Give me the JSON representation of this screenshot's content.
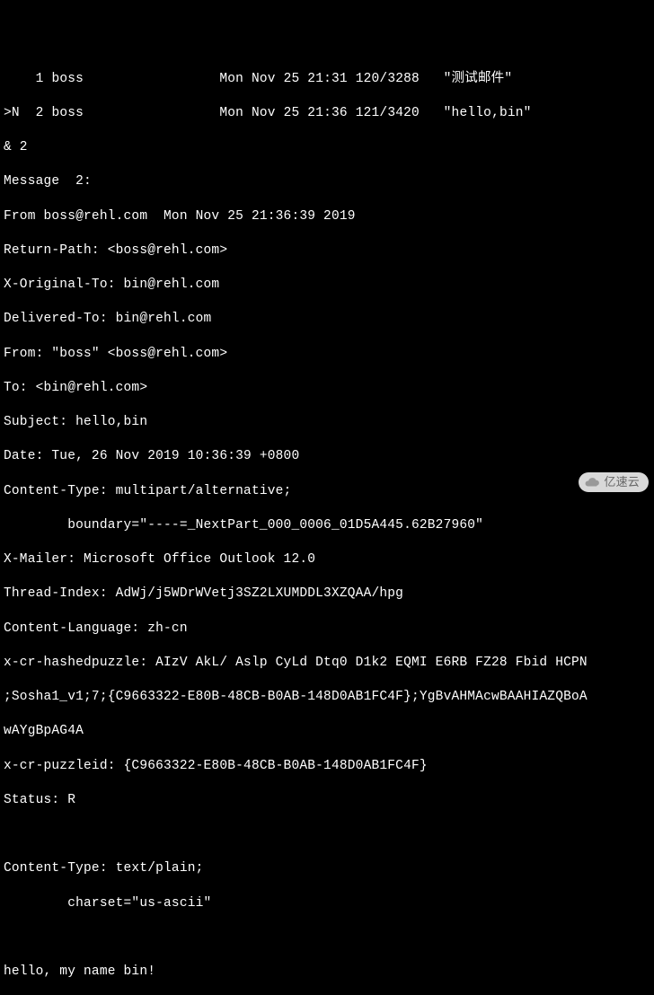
{
  "mail_list": [
    {
      "flag": "   ",
      "num": "1",
      "from": "boss",
      "date": "Mon Nov 25 21:31",
      "size": "120/3288",
      "subject": "\"测试邮件\""
    },
    {
      "flag": ">N ",
      "num": "2",
      "from": "boss",
      "date": "Mon Nov 25 21:36",
      "size": "121/3420",
      "subject": "\"hello,bin\""
    }
  ],
  "prompt": "& 2",
  "msg_header": "Message  2:",
  "headers": [
    "From boss@rehl.com  Mon Nov 25 21:36:39 2019",
    "Return-Path: <boss@rehl.com>",
    "X-Original-To: bin@rehl.com",
    "Delivered-To: bin@rehl.com",
    "From: \"boss\" <boss@rehl.com>",
    "To: <bin@rehl.com>",
    "Subject: hello,bin",
    "Date: Tue, 26 Nov 2019 10:36:39 +0800",
    "Content-Type: multipart/alternative;",
    "        boundary=\"----=_NextPart_000_0006_01D5A445.62B27960\"",
    "X-Mailer: Microsoft Office Outlook 12.0",
    "Thread-Index: AdWj/j5WDrWVetj3SZ2LXUMDDL3XZQAA/hpg",
    "Content-Language: zh-cn",
    "x-cr-hashedpuzzle: AIzV AkL/ Aslp CyLd Dtq0 D1k2 EQMI E6RB FZ28 Fbid HCPN",
    ";Sosha1_v1;7;{C9663322-E80B-48CB-B0AB-148D0AB1FC4F};YgBvAHMAcwBAAHIAZQBoA",
    "wAYgBpAG4A",
    "x-cr-puzzleid: {C9663322-E80B-48CB-B0AB-148D0AB1FC4F}",
    "Status: R"
  ],
  "part_header": [
    "Content-Type: text/plain;",
    "        charset=\"us-ascii\""
  ],
  "body": "hello, my name bin!",
  "watermark": "亿速云"
}
